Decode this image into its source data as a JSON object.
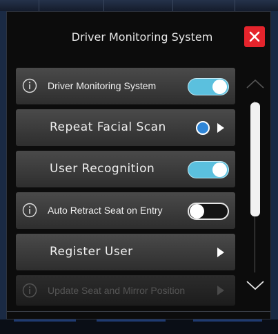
{
  "header": {
    "title": "Driver Monitoring System",
    "close_icon": "close-x-icon",
    "close_color": "#e5242c"
  },
  "rows": [
    {
      "label": "Driver Monitoring System",
      "control": "toggle",
      "state": "on",
      "info_icon": true
    },
    {
      "label": "Repeat Facial Scan",
      "control": "radio-arrow",
      "state": "selected",
      "info_icon": false
    },
    {
      "label": "User Recognition",
      "control": "toggle",
      "state": "on",
      "info_icon": false
    },
    {
      "label": "Auto Retract Seat on Entry",
      "control": "toggle",
      "state": "off",
      "info_icon": true
    },
    {
      "label": "Register User",
      "control": "arrow",
      "info_icon": false
    },
    {
      "label": "Update Seat and Mirror Position",
      "control": "arrow",
      "state": "disabled",
      "info_icon": true
    }
  ],
  "scroll": {
    "up_icon": "chevron-up-icon",
    "down_icon": "chevron-down-icon",
    "position": 0.0
  },
  "colors": {
    "toggle_on": "#5bc0de",
    "radio": "#2f86d8",
    "panel": "#0c0c0c",
    "row": "#3c3c3c"
  }
}
